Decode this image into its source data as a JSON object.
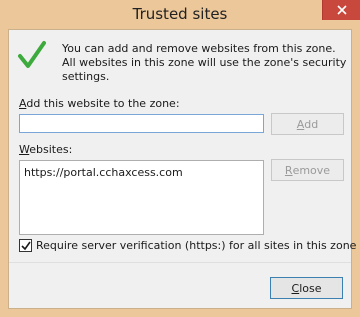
{
  "window": {
    "title": "Trusted sites"
  },
  "intro": {
    "text": "You can add and remove websites from this zone. All websites in this zone will use the zone's security settings."
  },
  "add_section": {
    "label_prefix": "A",
    "label_rest": "dd this website to the zone:",
    "input_value": "",
    "add_button": {
      "accel": "A",
      "rest": "dd"
    }
  },
  "websites": {
    "label_prefix": "W",
    "label_rest": "ebsites:",
    "items": [
      "https://portal.cchaxcess.com"
    ],
    "remove_button": {
      "accel": "R",
      "rest": "emove"
    }
  },
  "verification": {
    "checked": true,
    "label": "Require server verification (https:) for all sites in this zone"
  },
  "footer": {
    "close_button": {
      "accel": "C",
      "rest": "lose"
    }
  },
  "colors": {
    "title_bar": "#ecc79a",
    "close_button": "#c9483d",
    "checkmark": "#3caa3c",
    "input_focus_border": "#7aa7d8"
  },
  "icons": {
    "close": "close-icon",
    "checkmark": "checkmark-icon",
    "checkbox_check": "check-icon"
  }
}
